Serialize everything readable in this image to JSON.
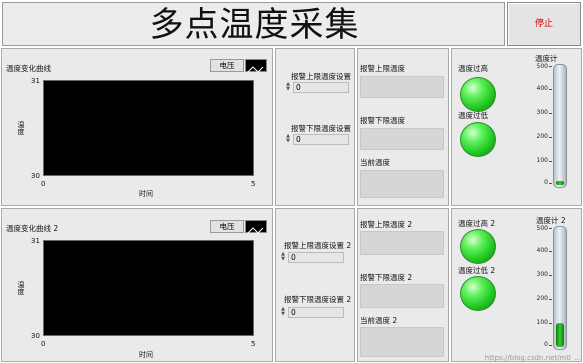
{
  "header": {
    "title": "多点温度采集",
    "stop_label": "停止"
  },
  "rows": [
    {
      "chart": {
        "label": "温度变化曲线",
        "ymax": "31",
        "ymin": "30",
        "xmin": "0",
        "xmax": "5",
        "xlabel": "时间",
        "ylabel": "温度",
        "legend": "电压"
      },
      "controls": {
        "upper_label": "报警上限温度设置",
        "upper_value": "0",
        "lower_label": "报警下限温度设置",
        "lower_value": "0"
      },
      "indicators": {
        "upper_label": "报警上限温度",
        "lower_label": "报警下限温度",
        "current_label": "当前温度"
      },
      "leds": {
        "high_label": "温度过高",
        "low_label": "温度过低"
      },
      "therm": {
        "label": "温度计",
        "ticks": [
          "500",
          "400",
          "300",
          "200",
          "100",
          "0"
        ],
        "level": 0.02
      }
    },
    {
      "chart": {
        "label": "温度变化曲线 2",
        "ymax": "31",
        "ymin": "30",
        "xmin": "0",
        "xmax": "5",
        "xlabel": "时间",
        "ylabel": "温度",
        "legend": "电压"
      },
      "controls": {
        "upper_label": "报警上限温度设置 2",
        "upper_value": "0",
        "lower_label": "报警下限温度设置 2",
        "lower_value": "0"
      },
      "indicators": {
        "upper_label": "报警上限温度 2",
        "lower_label": "报警下限温度 2",
        "current_label": "当前温度 2"
      },
      "leds": {
        "high_label": "温度过高 2",
        "low_label": "温度过低 2"
      },
      "therm": {
        "label": "温度计 2",
        "ticks": [
          "500",
          "400",
          "300",
          "200",
          "100",
          "0"
        ],
        "level": 0.2
      }
    }
  ],
  "watermark": "https://blog.csdn.net/m0_..."
}
